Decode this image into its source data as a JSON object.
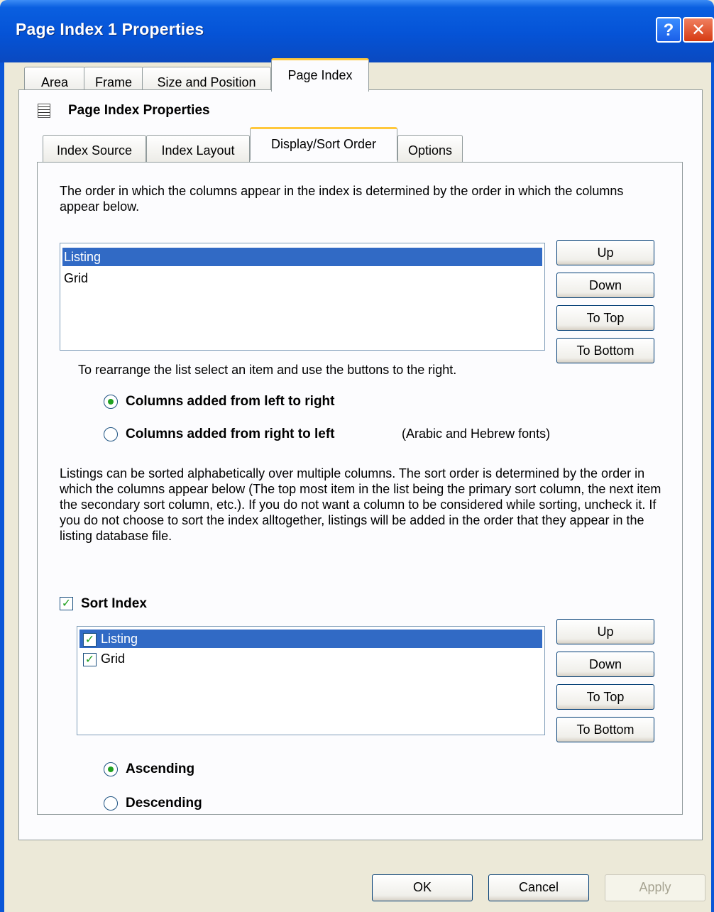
{
  "window": {
    "title": "Page Index 1 Properties",
    "help_glyph": "?",
    "close_glyph": "✕"
  },
  "outer_tabs": [
    "Area",
    "Frame",
    "Size and Position",
    "Page Index"
  ],
  "section_title": "Page Index Properties",
  "inner_tabs": [
    "Index Source",
    "Index Layout",
    "Display/Sort Order",
    "Options"
  ],
  "display": {
    "intro": "The order in which the columns appear in the index is determined by the order in which the columns appear below.",
    "list_items": [
      "Listing",
      "Grid"
    ],
    "buttons": {
      "up": "Up",
      "down": "Down",
      "to_top": "To Top",
      "to_bottom": "To Bottom"
    },
    "hint": "To rearrange the list select an item and use the buttons to the right.",
    "radio_ltr": "Columns added from left to right",
    "radio_rtl": "Columns added from right to left",
    "rtl_note": "(Arabic and Hebrew fonts)"
  },
  "sort": {
    "intro": "Listings can be sorted alphabetically over multiple columns.  The sort order is determined by the order in which the columns appear below (The top most item in the list being the primary sort column, the next item the secondary sort column, etc.).  If you do not want a column to be considered while sorting, uncheck it.  If you do not choose to sort the index alltogether, listings will be added in the order that they appear in the listing database file.",
    "sort_index_label": "Sort Index",
    "list_items": [
      "Listing",
      "Grid"
    ],
    "buttons": {
      "up": "Up",
      "down": "Down",
      "to_top": "To Top",
      "to_bottom": "To Bottom"
    },
    "ascending": "Ascending",
    "descending": "Descending"
  },
  "footer": {
    "ok": "OK",
    "cancel": "Cancel",
    "apply": "Apply"
  },
  "state": {
    "selected_outer_tab": "Page Index",
    "selected_inner_tab": "Display/Sort Order",
    "column_direction": "left-to-right",
    "sort_index_checked": true,
    "sort_direction": "ascending",
    "apply_enabled": false
  }
}
